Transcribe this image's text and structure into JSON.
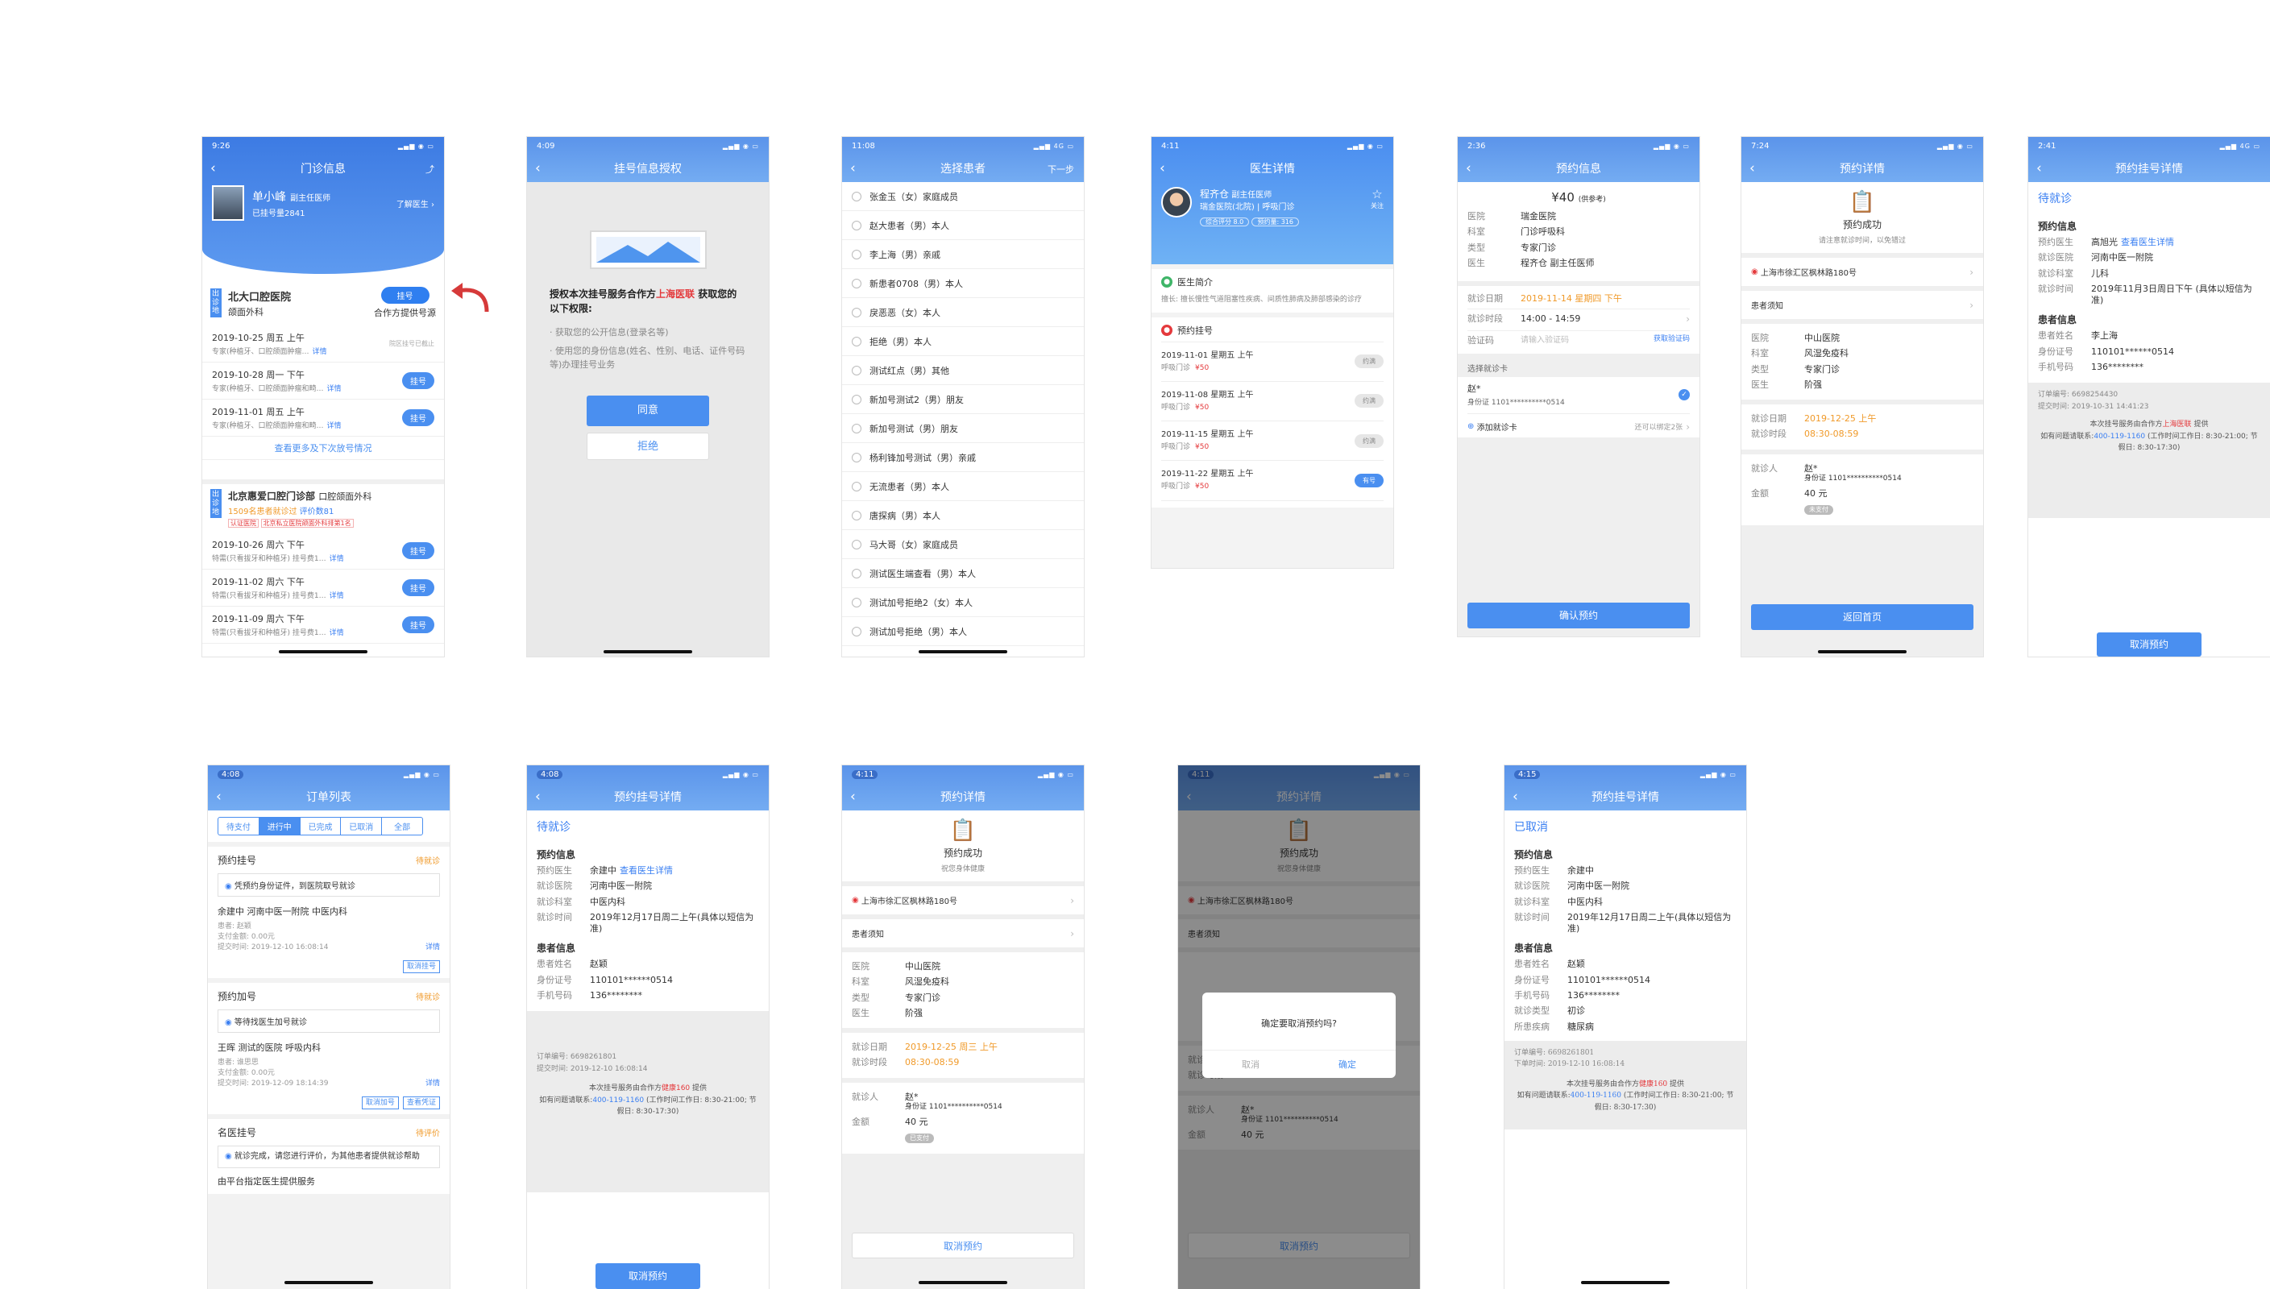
{
  "s1": {
    "time": "9:26",
    "title": "门诊信息",
    "doctor_name": "单小峰",
    "doctor_title": "副主任医师",
    "booked": "已挂号量2841",
    "know_doctor": "了解医生",
    "hosp1": {
      "tag": "出诊地",
      "name": "北大口腔医院",
      "dept": "颌面外科",
      "btn": "挂号",
      "note": "合作方提供号源"
    },
    "slots1": [
      {
        "date": "2019-10-25 周五 上午",
        "desc": "专家(种植牙、口腔颌面肿瘤…",
        "detail": "详情",
        "status": "院区挂号已截止",
        "btn": ""
      },
      {
        "date": "2019-10-28 周一 下午",
        "desc": "专家(种植牙、口腔颌面肿瘤和畸…",
        "detail": "详情",
        "status": "",
        "btn": "挂号"
      },
      {
        "date": "2019-11-01 周五 上午",
        "desc": "专家(种植牙、口腔颌面肿瘤和畸…",
        "detail": "详情",
        "status": "",
        "btn": "挂号"
      }
    ],
    "more": "查看更多及下次放号情况",
    "hosp2": {
      "tag": "出诊地",
      "name": "北京惠爱口腔门诊部",
      "dept": "口腔颌面外科",
      "count": "1509名患者就诊过",
      "rating": "评价数81",
      "cert": "认证医院",
      "rank": "北京私立医院颌面外科排第1名"
    },
    "slots2": [
      {
        "date": "2019-10-26 周六 下午",
        "desc": "特需(只看拔牙和种植牙) 挂号费1…",
        "detail": "详情",
        "btn": "挂号"
      },
      {
        "date": "2019-11-02 周六 下午",
        "desc": "特需(只看拔牙和种植牙) 挂号费1…",
        "detail": "详情",
        "btn": "挂号"
      },
      {
        "date": "2019-11-09 周六 下午",
        "desc": "特需(只看拔牙和种植牙) 挂号费1…",
        "detail": "详情",
        "btn": "挂号"
      }
    ]
  },
  "s2": {
    "time": "4:09",
    "title": "挂号信息授权",
    "intro_a": "授权本次挂号服务合作方",
    "partner": "上海医联",
    "intro_b": "获取您的以下权限:",
    "perm1": "获取您的公开信息(登录名等)",
    "perm2": "使用您的身份信息(姓名、性别、电话、证件号码等)办理挂号业务",
    "agree": "同意",
    "reject": "拒绝"
  },
  "s3": {
    "time": "11:08",
    "title": "选择患者",
    "next": "下一步",
    "patients": [
      "张金玉（女）家庭成员",
      "赵大患者（男）本人",
      "李上海（男）亲戚",
      "新患者0708（男）本人",
      "戾恶恶（女）本人",
      "拒绝（男）本人",
      "测试红点（男）其他",
      "新加号测试2（男）朋友",
      "新加号测试（男）朋友",
      "杨利锋加号测试（男）亲戚",
      "无流患者（男）本人",
      "唐探病（男）本人",
      "马大哥（女）家庭成员",
      "测试医生端查看（男）本人",
      "测试加号拒绝2（女）本人",
      "测试加号拒绝（男）本人"
    ]
  },
  "s4": {
    "time": "4:11",
    "title": "医生详情",
    "doc_name": "程齐仓",
    "doc_title": "副主任医师",
    "doc_hosp": "瑞金医院(北院)",
    "doc_dept": "呼吸门诊",
    "tag1": "综合评分 8.0",
    "tag2": "预约量: 316",
    "follow": "关注",
    "intro_title": "医生简介",
    "intro": "擅长: 擅长慢性气道阻塞性疾病、间质性肺病及肺部感染的诊疗",
    "book_title": "预约挂号",
    "slots": [
      {
        "date": "2019-11-01 星期五 上午",
        "type": "呼吸门诊",
        "price": "¥50",
        "btn": "约满"
      },
      {
        "date": "2019-11-08 星期五 上午",
        "type": "呼吸门诊",
        "price": "¥50",
        "btn": "约满"
      },
      {
        "date": "2019-11-15 星期五 上午",
        "type": "呼吸门诊",
        "price": "¥50",
        "btn": "约满"
      },
      {
        "date": "2019-11-22 星期五 上午",
        "type": "呼吸门诊",
        "price": "¥50",
        "btn": "有号"
      }
    ]
  },
  "s5": {
    "time": "2:36",
    "title": "预约信息",
    "price": "¥40",
    "price_note": "(供参考)",
    "rows": [
      {
        "k": "医院",
        "v": "瑞金医院"
      },
      {
        "k": "科室",
        "v": "门诊呼吸科"
      },
      {
        "k": "类型",
        "v": "专家门诊"
      },
      {
        "k": "医生",
        "v": "程齐仓 副主任医师"
      }
    ],
    "date_k": "就诊日期",
    "date_v": "2019-11-14 星期四 下午",
    "slot_k": "就诊时段",
    "slot_v": "14:00 - 14:59",
    "code_k": "验证码",
    "code_ph": "请输入验证码",
    "code_btn": "获取验证码",
    "card_title": "选择就诊卡",
    "card_name": "赵*",
    "card_id": "身份证 1101**********0514",
    "add_card": "添加就诊卡",
    "add_note": "还可以绑定2张",
    "confirm": "确认预约"
  },
  "s6": {
    "time": "7:24",
    "title": "预约详情",
    "success": "预约成功",
    "success_sub": "请注意就诊时间，以免错过",
    "addr": "上海市徐汇区枫林路180号",
    "guide": "患者须知",
    "rows": [
      {
        "k": "医院",
        "v": "中山医院"
      },
      {
        "k": "科室",
        "v": "风湿免疫科"
      },
      {
        "k": "类型",
        "v": "专家门诊"
      },
      {
        "k": "医生",
        "v": "阶强"
      }
    ],
    "date_k": "就诊日期",
    "date_v": "2019-12-25 上午",
    "slot_k": "就诊时段",
    "slot_v": "08:30-08:59",
    "person_k": "就诊人",
    "person_v": "赵*",
    "id_v": "身份证 1101**********0514",
    "fee_k": "金额",
    "fee_v": "40 元",
    "fee_tag": "未支付",
    "home": "返回首页"
  },
  "s7": {
    "time": "2:41",
    "title": "预约挂号详情",
    "state": "待就诊",
    "info_title": "预约信息",
    "rows": [
      {
        "k": "预约医生",
        "v": "高旭光",
        "link": "查看医生详情"
      },
      {
        "k": "就诊医院",
        "v": "河南中医一附院"
      },
      {
        "k": "就诊科室",
        "v": "儿科"
      },
      {
        "k": "就诊时间",
        "v": "2019年11月3日周日下午 (具体以短信为准)"
      }
    ],
    "patient_title": "患者信息",
    "prows": [
      {
        "k": "患者姓名",
        "v": "李上海"
      },
      {
        "k": "身份证号",
        "v": "110101******0514"
      },
      {
        "k": "手机号码",
        "v": "136********"
      }
    ],
    "order_no": "订单编号: 6698254430",
    "submit_time": "提交时间: 2019-10-31 14:41:23",
    "svc_a": "本次挂号服务由合作方",
    "svc_partner": "上海医联",
    "svc_b": "提供",
    "svc_c": "如有问题请联系:",
    "svc_phone": "400-119-1160",
    "svc_d": "(工作时间工作日: 8:30-21:00; 节假日: 8:30-17:30)",
    "cancel": "取消预约"
  },
  "s8": {
    "time": "4:08",
    "title": "订单列表",
    "tabs": [
      "待支付",
      "进行中",
      "已完成",
      "已取消",
      "全部"
    ],
    "o1": {
      "title": "预约挂号",
      "state": "待就诊",
      "tip": "凭预约身份证件，到医院取号就诊",
      "hosp": "余建中 河南中医一附院 中医内科",
      "p": "患者: 赵颖",
      "pay": "支付金额: 0.00元",
      "time": "提交时间: 2019-12-10 16:08:14",
      "detail": "详情",
      "btn": "取消挂号"
    },
    "o2": {
      "title": "预约加号",
      "state": "待就诊",
      "tip": "等待找医生加号就诊",
      "hosp": "王晖 测试的医院 呼吸内科",
      "p": "患者: 谁思思",
      "pay": "支付金额: 0.00元",
      "time": "提交时间: 2019-12-09 18:14:39",
      "detail": "详情",
      "btn1": "取消加号",
      "btn2": "查看凭证"
    },
    "o3": {
      "title": "名医挂号",
      "state": "待评价",
      "tip": "就诊完成，请您进行评价，为其他患者提供就诊帮助",
      "foot": "由平台指定医生提供服务"
    }
  },
  "s9": {
    "time": "4:08",
    "title": "预约挂号详情",
    "state": "待就诊",
    "info_title": "预约信息",
    "rows": [
      {
        "k": "预约医生",
        "v": "余建中",
        "link": "查看医生详情"
      },
      {
        "k": "就诊医院",
        "v": "河南中医一附院"
      },
      {
        "k": "就诊科室",
        "v": "中医内科"
      },
      {
        "k": "就诊时间",
        "v": "2019年12月17日周二上午(具体以短信为准)"
      }
    ],
    "patient_title": "患者信息",
    "prows": [
      {
        "k": "患者姓名",
        "v": "赵颖"
      },
      {
        "k": "身份证号",
        "v": "110101******0514"
      },
      {
        "k": "手机号码",
        "v": "136********"
      }
    ],
    "order_no": "订单编号: 6698261801",
    "submit_time": "提交时间: 2019-12-10 16:08:14",
    "svc_a": "本次挂号服务由合作方",
    "svc_partner": "健康160",
    "svc_b": "提供",
    "svc_c": "如有问题请联系:",
    "svc_phone": "400-119-1160",
    "svc_d": "(工作时间工作日: 8:30-21:00; 节假日: 8:30-17:30)",
    "cancel": "取消预约"
  },
  "s10": {
    "time": "4:11",
    "title": "预约详情",
    "success": "预约成功",
    "success_sub": "祝您身体健康",
    "addr": "上海市徐汇区枫林路180号",
    "guide": "患者须知",
    "rows": [
      {
        "k": "医院",
        "v": "中山医院"
      },
      {
        "k": "科室",
        "v": "风湿免疫科"
      },
      {
        "k": "类型",
        "v": "专家门诊"
      },
      {
        "k": "医生",
        "v": "阶强"
      }
    ],
    "date_k": "就诊日期",
    "date_v": "2019-12-25 周三 上午",
    "slot_k": "就诊时段",
    "slot_v": "08:30-08:59",
    "person_k": "就诊人",
    "person_v": "赵*",
    "id_v": "身份证 1101**********0514",
    "fee_k": "金额",
    "fee_v": "40 元",
    "fee_tag": "已支付",
    "cancel": "取消预约"
  },
  "s11": {
    "dialog_text": "确定要取消预约吗?",
    "dialog_cancel": "取消",
    "dialog_ok": "确定"
  },
  "s12": {
    "time": "4:15",
    "title": "预约挂号详情",
    "state": "已取消",
    "info_title": "预约信息",
    "rows": [
      {
        "k": "预约医生",
        "v": "余建中"
      },
      {
        "k": "就诊医院",
        "v": "河南中医一附院"
      },
      {
        "k": "就诊科室",
        "v": "中医内科"
      },
      {
        "k": "就诊时间",
        "v": "2019年12月17日周二上午(具体以短信为准)"
      }
    ],
    "patient_title": "患者信息",
    "prows": [
      {
        "k": "患者姓名",
        "v": "赵颖"
      },
      {
        "k": "身份证号",
        "v": "110101******0514"
      },
      {
        "k": "手机号码",
        "v": "136********"
      },
      {
        "k": "就诊类型",
        "v": "初诊"
      },
      {
        "k": "所患疾病",
        "v": "糖尿病"
      }
    ],
    "order_no": "订单编号: 6698261801",
    "submit_time": "下单时间: 2019-12-10 16:08:14",
    "svc_a": "本次挂号服务由合作方",
    "svc_partner": "健康160",
    "svc_b": "提供",
    "svc_c": "如有问题请联系:",
    "svc_phone": "400-119-1160",
    "svc_d": "(工作时间工作日: 8:30-21:00; 节假日: 8:30-17:30)"
  }
}
